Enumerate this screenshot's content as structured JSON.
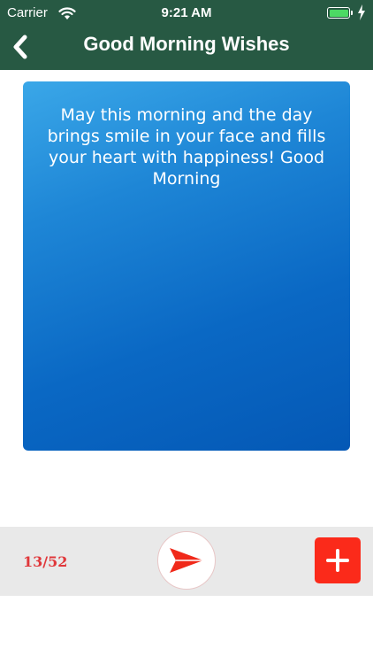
{
  "status_bar": {
    "carrier": "Carrier",
    "time": "9:21 AM",
    "wifi_icon": "wifi-icon",
    "battery_icon": "battery-icon",
    "charging_icon": "charging-bolt-icon"
  },
  "header": {
    "title": "Good Morning Wishes",
    "back_icon": "chevron-left-icon",
    "background_color": "#275943"
  },
  "message": {
    "text": "May this morning and the day brings smile in your face and fills your heart with happiness! Good Morning"
  },
  "footer": {
    "counter": "13/52",
    "send_icon": "paper-plane-icon",
    "add_icon": "plus-icon",
    "accent_color": "#fb2a1a"
  }
}
